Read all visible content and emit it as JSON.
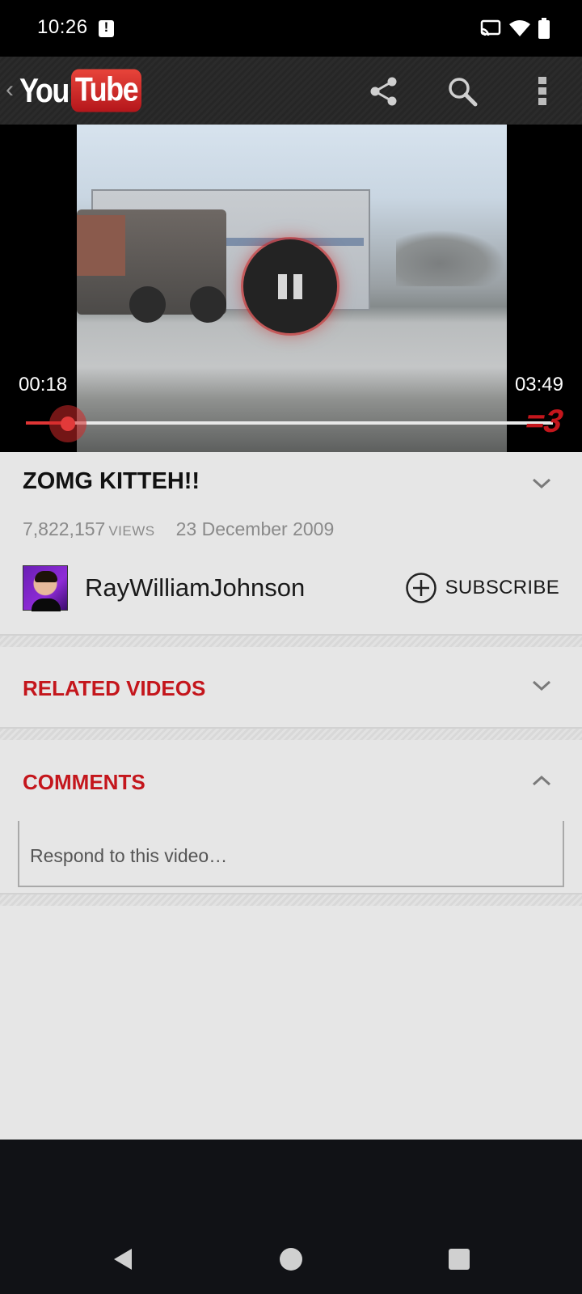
{
  "status_bar": {
    "time": "10:26",
    "icons": [
      "notification-alert-icon",
      "cast-icon",
      "wifi-icon",
      "battery-icon"
    ]
  },
  "app_bar": {
    "logo_you": "You",
    "logo_tube": "Tube",
    "actions": [
      "share-icon",
      "search-icon",
      "overflow-menu-icon"
    ]
  },
  "player": {
    "current_time": "00:18",
    "total_time": "03:49",
    "progress": 0.079,
    "watermark": "=3",
    "state": "playing",
    "accent_color": "#e03535"
  },
  "video": {
    "title": "ZOMG KITTEH!!",
    "views": "7,822,157",
    "views_label": "VIEWS",
    "date": "23 December 2009"
  },
  "channel": {
    "name": "RayWilliamJohnson",
    "subscribe_label": "SUBSCRIBE"
  },
  "sections": {
    "related": {
      "title": "RELATED VIDEOS",
      "expanded": false
    },
    "comments": {
      "title": "COMMENTS",
      "expanded": true,
      "input_placeholder": "Respond to this video…"
    }
  },
  "colors": {
    "section_title": "#c4161c",
    "background": "#e6e6e6"
  },
  "nav_bar": [
    "back-icon",
    "home-icon",
    "recents-icon"
  ]
}
